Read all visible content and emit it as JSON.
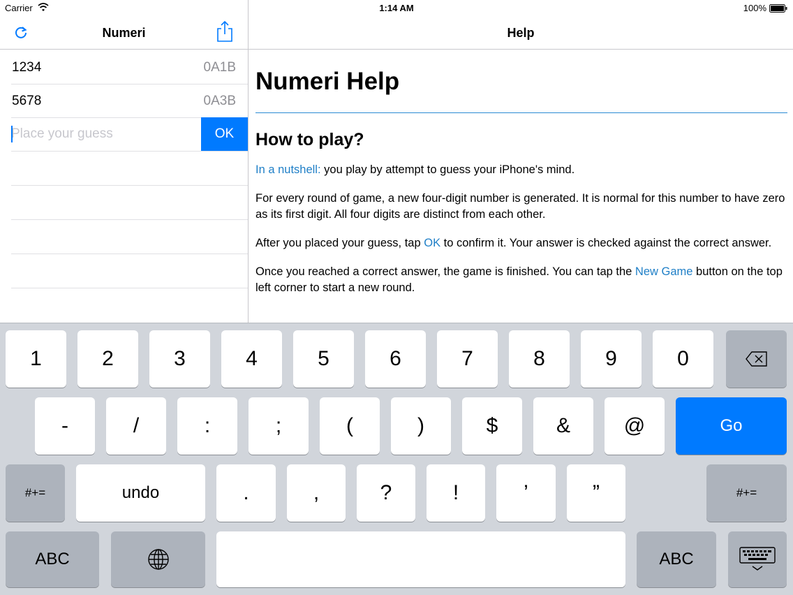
{
  "status_bar": {
    "carrier": "Carrier",
    "time": "1:14 AM",
    "battery": "100%"
  },
  "master": {
    "title": "Numeri",
    "guesses": [
      {
        "guess": "1234",
        "result": "0A1B"
      },
      {
        "guess": "5678",
        "result": "0A3B"
      }
    ],
    "input_placeholder": "Place your guess",
    "ok_label": "OK"
  },
  "detail": {
    "title": "Help",
    "heading": "Numeri Help",
    "subheading": "How to play?",
    "p1_link": "In a nutshell:",
    "p1_text": " you play by attempt to guess your iPhone's mind.",
    "p2_text": "For every round of game, a new four-digit number is generated. It is normal for this number to have zero as its first digit. All four digits are distinct from each other.",
    "p3_pre": "After you placed your guess, tap ",
    "p3_link": "OK",
    "p3_post": " to confirm it. Your answer is checked against the correct answer.",
    "p4_pre": "Once you reached a correct answer, the game is finished. You can tap the ",
    "p4_link": "New Game",
    "p4_post": " button on the top left corner to start a new round."
  },
  "keyboard": {
    "row1": [
      "1",
      "2",
      "3",
      "4",
      "5",
      "6",
      "7",
      "8",
      "9",
      "0"
    ],
    "row2": [
      "-",
      "/",
      ":",
      ";",
      "(",
      ")",
      "$",
      "&",
      "@"
    ],
    "go": "Go",
    "shift_sym": "#+=",
    "undo": "undo",
    "row3": [
      ".",
      ",",
      "?",
      "!",
      "’",
      "”"
    ],
    "abc": "ABC",
    "icons": [
      "backspace-icon",
      "globe-icon",
      "keyboard-dismiss-icon"
    ]
  },
  "colors": {
    "accent": "#007aff",
    "link": "#1f7fc7",
    "keyboard_bg": "#d1d5db"
  }
}
